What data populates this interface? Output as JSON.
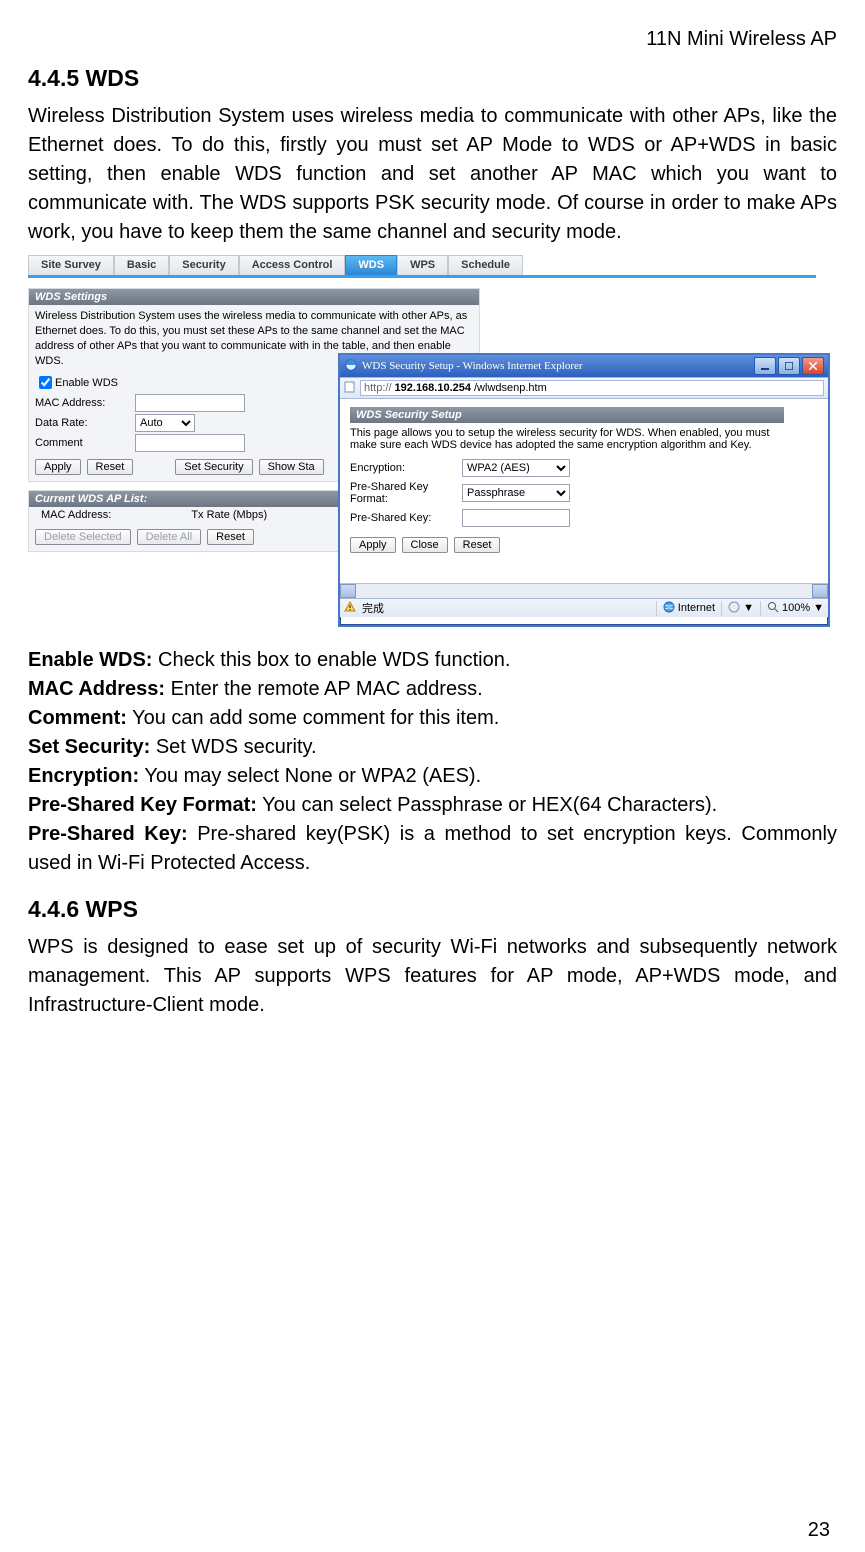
{
  "header": {
    "product": "11N Mini Wireless AP"
  },
  "sections": {
    "wds": {
      "heading": "4.4.5 WDS",
      "intro": "Wireless Distribution System uses wireless media to communicate with other APs, like the Ethernet does. To do this, firstly you must set AP Mode to WDS or AP+WDS in basic setting, then enable WDS function and set another AP MAC which you want to communicate with. The WDS supports PSK security mode. Of course in order to make APs work, you have to keep them the same channel and security mode."
    },
    "wps": {
      "heading": "4.4.6 WPS",
      "intro": "WPS is designed to ease set up of security Wi-Fi networks and subsequently network management. This AP supports WPS features for AP mode, AP+WDS mode, and Infrastructure-Client mode."
    }
  },
  "definitions": [
    {
      "term": "Enable WDS:",
      "desc": " Check this box to enable WDS function."
    },
    {
      "term": "MAC Address:",
      "desc": " Enter the remote AP MAC address."
    },
    {
      "term": "Comment:",
      "desc": " You can add some comment for this item."
    },
    {
      "term": "Set Security:",
      "desc": " Set WDS security."
    },
    {
      "term": "Encryption:",
      "desc": " You may select None or WPA2 (AES)."
    },
    {
      "term": "Pre-Shared Key Format:",
      "desc": " You can select Passphrase or HEX(64 Characters)."
    },
    {
      "term": "Pre-Shared Key:",
      "desc": " Pre-shared key(PSK) is a method to set encryption keys. Commonly used in Wi-Fi Protected Access."
    }
  ],
  "figure": {
    "tabs": [
      "Site Survey",
      "Basic",
      "Security",
      "Access Control",
      "WDS",
      "WPS",
      "Schedule"
    ],
    "active_tab": "WDS",
    "wds_panel": {
      "title": "WDS Settings",
      "desc": "Wireless Distribution System uses the wireless media to communicate with other APs, as Ethernet does. To do this, you must set these APs to the same channel and set the MAC address of other APs that you want to communicate with in the table, and then enable WDS.",
      "enable_label": "Enable WDS",
      "mac_label": "MAC Address:",
      "rate_label": "Data Rate:",
      "rate_value": "Auto",
      "comment_label": "Comment",
      "buttons": {
        "apply": "Apply",
        "reset": "Reset",
        "set_sec": "Set Security",
        "show": "Show Sta"
      }
    },
    "aplist": {
      "title": "Current WDS AP List:",
      "col1": "MAC Address:",
      "col2": "Tx Rate (Mbps)",
      "buttons": {
        "del_sel": "Delete Selected",
        "del_all": "Delete All",
        "reset": "Reset"
      }
    },
    "popup": {
      "window_title": "WDS Security Setup - Windows Internet Explorer",
      "url_host": "192.168.10.254",
      "url_path": "/wlwdsenp.htm",
      "panel_title": "WDS Security Setup",
      "panel_desc": "This page allows you to setup the wireless security for WDS. When enabled, you must make sure each WDS device has adopted the same encryption algorithm and Key.",
      "enc_label": "Encryption:",
      "enc_value": "WPA2 (AES)",
      "pskf_label": "Pre-Shared Key Format:",
      "pskf_value": "Passphrase",
      "psk_label": "Pre-Shared Key:",
      "buttons": {
        "apply": "Apply",
        "close": "Close",
        "reset": "Reset"
      },
      "status_done": "完成",
      "status_net": "Internet",
      "zoom": "100%"
    }
  },
  "page_number": "23"
}
